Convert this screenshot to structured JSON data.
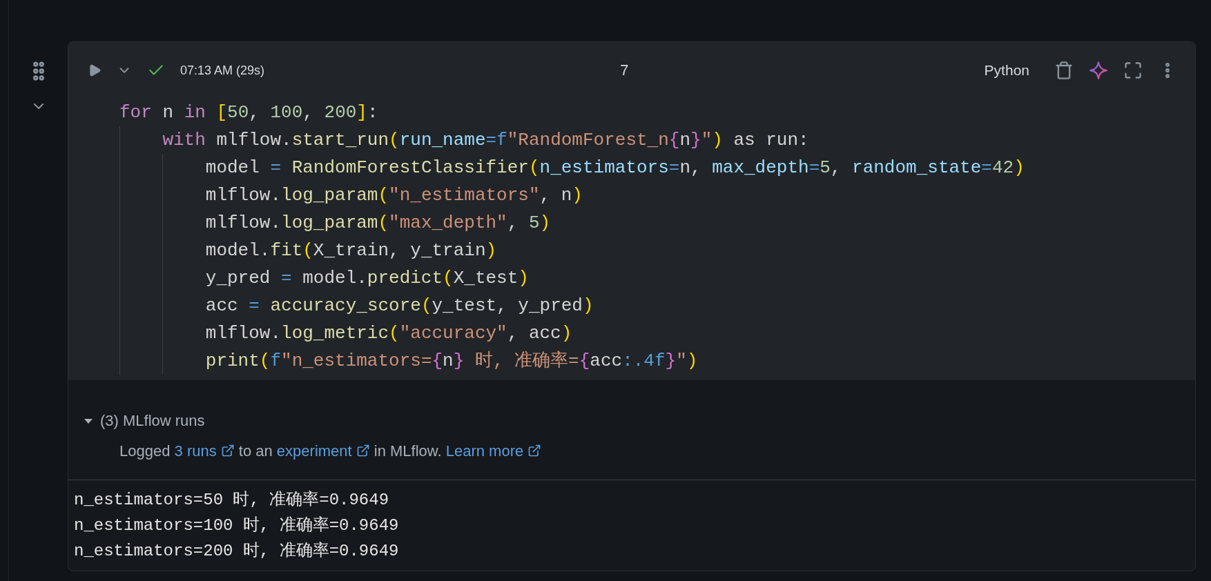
{
  "cell": {
    "succeeded": true,
    "run_time": "07:13 AM (29s)",
    "cell_number": "7",
    "language": "Python",
    "collapsed": false,
    "code": [
      {
        "tokens": [
          {
            "kind": "keyword",
            "text": "for"
          },
          {
            "kind": "plain",
            "text": " n "
          },
          {
            "kind": "keyword",
            "text": "in"
          },
          {
            "kind": "bracket",
            "text": " ["
          },
          {
            "kind": "number",
            "text": "50"
          },
          {
            "kind": "plain",
            "text": ", "
          },
          {
            "kind": "number",
            "text": "100"
          },
          {
            "kind": "plain",
            "text": ", "
          },
          {
            "kind": "number",
            "text": "200"
          },
          {
            "kind": "bracket",
            "text": "]"
          },
          {
            "kind": "plain",
            "text": ":"
          }
        ],
        "children": [
          {
            "tokens": [
              {
                "kind": "keyword",
                "text": "with"
              },
              {
                "kind": "plain",
                "text": " mlflow."
              },
              {
                "kind": "function",
                "text": "start_run"
              },
              {
                "kind": "bracket",
                "text": "("
              },
              {
                "kind": "param",
                "text": "run_name"
              },
              {
                "kind": "operator",
                "text": "="
              },
              {
                "kind": "prefix",
                "text": "f"
              },
              {
                "kind": "string",
                "text": "\"RandomForest_n"
              },
              {
                "kind": "brace",
                "text": "{"
              },
              {
                "kind": "plain",
                "text": "n"
              },
              {
                "kind": "brace",
                "text": "}"
              },
              {
                "kind": "string",
                "text": "\""
              },
              {
                "kind": "bracket",
                "text": ")"
              },
              {
                "kind": "plain",
                "text": " as run:"
              }
            ],
            "children": [
              {
                "tokens": [
                  {
                    "kind": "plain",
                    "text": "model "
                  },
                  {
                    "kind": "operator",
                    "text": "= "
                  },
                  {
                    "kind": "function",
                    "text": "RandomForestClassifier"
                  },
                  {
                    "kind": "bracket",
                    "text": "("
                  },
                  {
                    "kind": "param",
                    "text": "n_estimators"
                  },
                  {
                    "kind": "operator",
                    "text": "="
                  },
                  {
                    "kind": "plain",
                    "text": "n, "
                  },
                  {
                    "kind": "param",
                    "text": "max_depth"
                  },
                  {
                    "kind": "operator",
                    "text": "="
                  },
                  {
                    "kind": "number",
                    "text": "5"
                  },
                  {
                    "kind": "plain",
                    "text": ", "
                  },
                  {
                    "kind": "param",
                    "text": "random_state"
                  },
                  {
                    "kind": "operator",
                    "text": "="
                  },
                  {
                    "kind": "number",
                    "text": "42"
                  },
                  {
                    "kind": "bracket",
                    "text": ")"
                  }
                ]
              },
              {
                "tokens": [
                  {
                    "kind": "plain",
                    "text": "mlflow."
                  },
                  {
                    "kind": "function",
                    "text": "log_param"
                  },
                  {
                    "kind": "bracket",
                    "text": "("
                  },
                  {
                    "kind": "string",
                    "text": "\"n_estimators\""
                  },
                  {
                    "kind": "plain",
                    "text": ", n"
                  },
                  {
                    "kind": "bracket",
                    "text": ")"
                  }
                ]
              },
              {
                "tokens": [
                  {
                    "kind": "plain",
                    "text": "mlflow."
                  },
                  {
                    "kind": "function",
                    "text": "log_param"
                  },
                  {
                    "kind": "bracket",
                    "text": "("
                  },
                  {
                    "kind": "string",
                    "text": "\"max_depth\""
                  },
                  {
                    "kind": "plain",
                    "text": ", "
                  },
                  {
                    "kind": "number",
                    "text": "5"
                  },
                  {
                    "kind": "bracket",
                    "text": ")"
                  }
                ]
              },
              {
                "tokens": [
                  {
                    "kind": "plain",
                    "text": "model."
                  },
                  {
                    "kind": "function",
                    "text": "fit"
                  },
                  {
                    "kind": "bracket",
                    "text": "("
                  },
                  {
                    "kind": "plain",
                    "text": "X_train, y_train"
                  },
                  {
                    "kind": "bracket",
                    "text": ")"
                  }
                ]
              },
              {
                "tokens": [
                  {
                    "kind": "plain",
                    "text": "y_pred "
                  },
                  {
                    "kind": "operator",
                    "text": "="
                  },
                  {
                    "kind": "plain",
                    "text": " model."
                  },
                  {
                    "kind": "function",
                    "text": "predict"
                  },
                  {
                    "kind": "bracket",
                    "text": "("
                  },
                  {
                    "kind": "plain",
                    "text": "X_test"
                  },
                  {
                    "kind": "bracket",
                    "text": ")"
                  }
                ]
              },
              {
                "tokens": [
                  {
                    "kind": "plain",
                    "text": "acc "
                  },
                  {
                    "kind": "operator",
                    "text": "= "
                  },
                  {
                    "kind": "function",
                    "text": "accuracy_score"
                  },
                  {
                    "kind": "bracket",
                    "text": "("
                  },
                  {
                    "kind": "plain",
                    "text": "y_test, y_pred"
                  },
                  {
                    "kind": "bracket",
                    "text": ")"
                  }
                ]
              },
              {
                "tokens": [
                  {
                    "kind": "plain",
                    "text": "mlflow."
                  },
                  {
                    "kind": "function",
                    "text": "log_metric"
                  },
                  {
                    "kind": "bracket",
                    "text": "("
                  },
                  {
                    "kind": "string",
                    "text": "\"accuracy\""
                  },
                  {
                    "kind": "plain",
                    "text": ", acc"
                  },
                  {
                    "kind": "bracket",
                    "text": ")"
                  }
                ]
              },
              {
                "tokens": [
                  {
                    "kind": "function",
                    "text": "print"
                  },
                  {
                    "kind": "bracket",
                    "text": "("
                  },
                  {
                    "kind": "prefix",
                    "text": "f"
                  },
                  {
                    "kind": "string",
                    "text": "\"n_estimators="
                  },
                  {
                    "kind": "brace",
                    "text": "{"
                  },
                  {
                    "kind": "plain",
                    "text": "n"
                  },
                  {
                    "kind": "brace",
                    "text": "}"
                  },
                  {
                    "kind": "string",
                    "text": " 时, 准确率="
                  },
                  {
                    "kind": "brace",
                    "text": "{"
                  },
                  {
                    "kind": "plain",
                    "text": "acc"
                  },
                  {
                    "kind": "prefix",
                    "text": ":.4f"
                  },
                  {
                    "kind": "brace",
                    "text": "}"
                  },
                  {
                    "kind": "string",
                    "text": "\""
                  },
                  {
                    "kind": "bracket",
                    "text": ")"
                  }
                ]
              }
            ]
          }
        ]
      }
    ]
  },
  "mlflow": {
    "title": "(3) MLflow runs",
    "expanded": true,
    "message": [
      {
        "kind": "text",
        "text": "Logged "
      },
      {
        "kind": "link",
        "text": "3 runs"
      },
      {
        "kind": "text",
        "text": " to an "
      },
      {
        "kind": "link",
        "text": "experiment"
      },
      {
        "kind": "text",
        "text": " in MLflow. "
      },
      {
        "kind": "link",
        "text": "Learn more"
      }
    ]
  },
  "output": [
    "n_estimators=50 时, 准确率=0.9649",
    "n_estimators=100 时, 准确率=0.9649",
    "n_estimators=200 时, 准确率=0.9649"
  ]
}
